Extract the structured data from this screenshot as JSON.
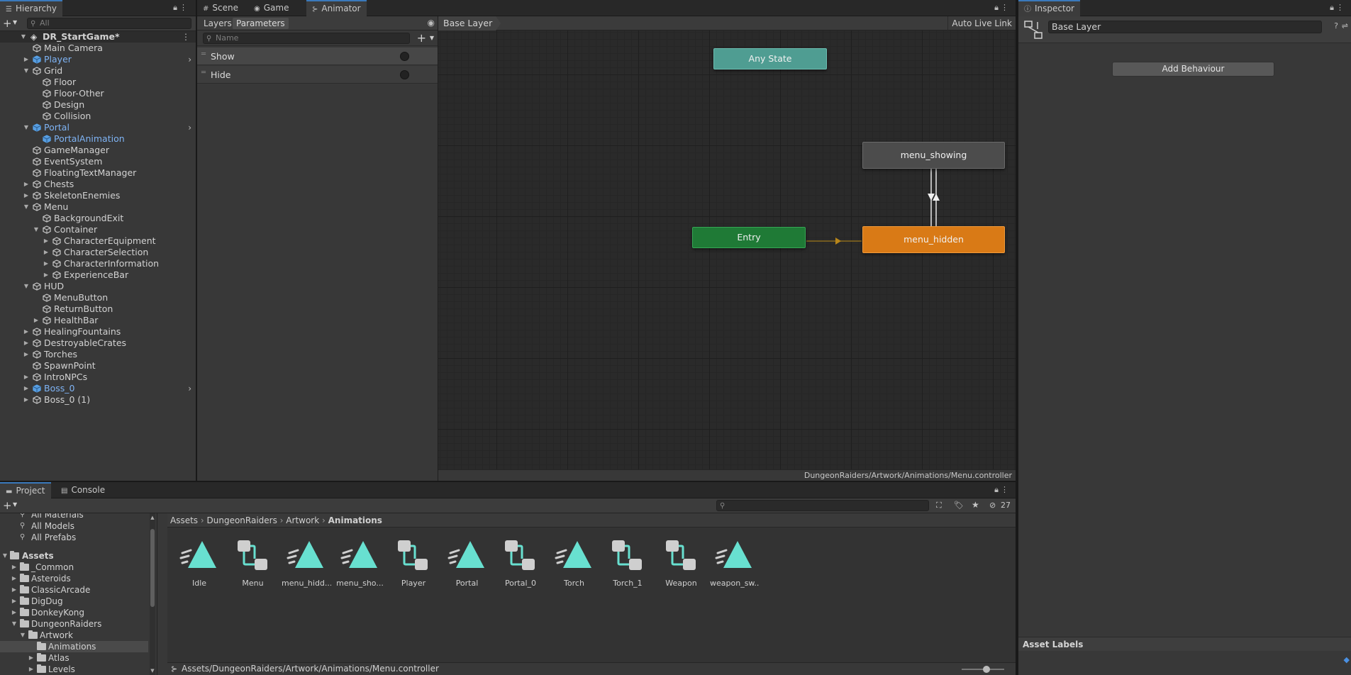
{
  "hierarchy": {
    "tab_label": "Hierarchy",
    "search_placeholder": "All",
    "scene_name": "DR_StartGame*",
    "items": [
      {
        "label": "Main Camera",
        "depth": 1,
        "arrow": "",
        "prefab": false,
        "chevron": false
      },
      {
        "label": "Player",
        "depth": 1,
        "arrow": "right",
        "prefab": true,
        "chevron": true
      },
      {
        "label": "Grid",
        "depth": 1,
        "arrow": "down",
        "prefab": false,
        "chevron": false
      },
      {
        "label": "Floor",
        "depth": 2,
        "arrow": "",
        "prefab": false,
        "chevron": false
      },
      {
        "label": "Floor-Other",
        "depth": 2,
        "arrow": "",
        "prefab": false,
        "chevron": false
      },
      {
        "label": "Design",
        "depth": 2,
        "arrow": "",
        "prefab": false,
        "chevron": false
      },
      {
        "label": "Collision",
        "depth": 2,
        "arrow": "",
        "prefab": false,
        "chevron": false
      },
      {
        "label": "Portal",
        "depth": 1,
        "arrow": "down",
        "prefab": true,
        "chevron": true
      },
      {
        "label": "PortalAnimation",
        "depth": 2,
        "arrow": "",
        "prefab": true,
        "chevron": false
      },
      {
        "label": "GameManager",
        "depth": 1,
        "arrow": "",
        "prefab": false,
        "chevron": false
      },
      {
        "label": "EventSystem",
        "depth": 1,
        "arrow": "",
        "prefab": false,
        "chevron": false
      },
      {
        "label": "FloatingTextManager",
        "depth": 1,
        "arrow": "",
        "prefab": false,
        "chevron": false
      },
      {
        "label": "Chests",
        "depth": 1,
        "arrow": "right",
        "prefab": false,
        "chevron": false
      },
      {
        "label": "SkeletonEnemies",
        "depth": 1,
        "arrow": "right",
        "prefab": false,
        "chevron": false
      },
      {
        "label": "Menu",
        "depth": 1,
        "arrow": "down",
        "prefab": false,
        "chevron": false
      },
      {
        "label": "BackgroundExit",
        "depth": 2,
        "arrow": "",
        "prefab": false,
        "chevron": false
      },
      {
        "label": "Container",
        "depth": 2,
        "arrow": "down",
        "prefab": false,
        "chevron": false
      },
      {
        "label": "CharacterEquipment",
        "depth": 3,
        "arrow": "right",
        "prefab": false,
        "chevron": false
      },
      {
        "label": "CharacterSelection",
        "depth": 3,
        "arrow": "right",
        "prefab": false,
        "chevron": false
      },
      {
        "label": "CharacterInformation",
        "depth": 3,
        "arrow": "right",
        "prefab": false,
        "chevron": false
      },
      {
        "label": "ExperienceBar",
        "depth": 3,
        "arrow": "right",
        "prefab": false,
        "chevron": false
      },
      {
        "label": "HUD",
        "depth": 1,
        "arrow": "down",
        "prefab": false,
        "chevron": false
      },
      {
        "label": "MenuButton",
        "depth": 2,
        "arrow": "",
        "prefab": false,
        "chevron": false
      },
      {
        "label": "ReturnButton",
        "depth": 2,
        "arrow": "",
        "prefab": false,
        "chevron": false
      },
      {
        "label": "HealthBar",
        "depth": 2,
        "arrow": "right",
        "prefab": false,
        "chevron": false
      },
      {
        "label": "HealingFountains",
        "depth": 1,
        "arrow": "right",
        "prefab": false,
        "chevron": false
      },
      {
        "label": "DestroyableCrates",
        "depth": 1,
        "arrow": "right",
        "prefab": false,
        "chevron": false
      },
      {
        "label": "Torches",
        "depth": 1,
        "arrow": "right",
        "prefab": false,
        "chevron": false
      },
      {
        "label": "SpawnPoint",
        "depth": 1,
        "arrow": "",
        "prefab": false,
        "chevron": false
      },
      {
        "label": "IntroNPCs",
        "depth": 1,
        "arrow": "right",
        "prefab": false,
        "chevron": false
      },
      {
        "label": "Boss_0",
        "depth": 1,
        "arrow": "right",
        "prefab": true,
        "chevron": true
      },
      {
        "label": "Boss_0 (1)",
        "depth": 1,
        "arrow": "right",
        "prefab": false,
        "chevron": false
      }
    ]
  },
  "center_tabs": {
    "scene": "Scene",
    "game": "Game",
    "animator": "Animator"
  },
  "animator": {
    "layers_tab": "Layers",
    "parameters_tab": "Parameters",
    "name_placeholder": "Name",
    "parameters": [
      "Show",
      "Hide"
    ],
    "breadcrumb": "Base Layer",
    "auto_live_link": "Auto Live Link",
    "nodes": {
      "any_state": "Any State",
      "entry": "Entry",
      "menu_showing": "menu_showing",
      "menu_hidden": "menu_hidden"
    },
    "footer_path": "DungeonRaiders/Artwork/Animations/Menu.controller",
    "colors": {
      "any_state": "#4f9d92",
      "entry": "#1f7a36",
      "default_state": "#d97a16",
      "state": "#4c4c4c"
    }
  },
  "inspector": {
    "tab_label": "Inspector",
    "layer_name": "Base Layer",
    "add_behaviour": "Add Behaviour",
    "asset_labels": "Asset Labels"
  },
  "project": {
    "tab_label": "Project",
    "console_label": "Console",
    "hidden_count": "27",
    "favorites": [
      "All Materials",
      "All Models",
      "All Prefabs"
    ],
    "assets_root": "Assets",
    "folders": [
      {
        "label": "_Common",
        "depth": 1,
        "arrow": "right"
      },
      {
        "label": "Asteroids",
        "depth": 1,
        "arrow": "right"
      },
      {
        "label": "ClassicArcade",
        "depth": 1,
        "arrow": "right"
      },
      {
        "label": "DigDug",
        "depth": 1,
        "arrow": "right"
      },
      {
        "label": "DonkeyKong",
        "depth": 1,
        "arrow": "right"
      },
      {
        "label": "DungeonRaiders",
        "depth": 1,
        "arrow": "down"
      },
      {
        "label": "Artwork",
        "depth": 2,
        "arrow": "down"
      },
      {
        "label": "Animations",
        "depth": 3,
        "arrow": ""
      },
      {
        "label": "Atlas",
        "depth": 3,
        "arrow": "right"
      },
      {
        "label": "Levels",
        "depth": 3,
        "arrow": "right"
      }
    ],
    "breadcrumb": [
      "Assets",
      "DungeonRaiders",
      "Artwork",
      "Animations"
    ],
    "assets": [
      {
        "name": "Idle",
        "kind": "clip"
      },
      {
        "name": "Menu",
        "kind": "controller"
      },
      {
        "name": "menu_hidd...",
        "kind": "clip"
      },
      {
        "name": "menu_sho...",
        "kind": "clip"
      },
      {
        "name": "Player",
        "kind": "controller"
      },
      {
        "name": "Portal",
        "kind": "clip"
      },
      {
        "name": "Portal_0",
        "kind": "controller"
      },
      {
        "name": "Torch",
        "kind": "clip"
      },
      {
        "name": "Torch_1",
        "kind": "controller"
      },
      {
        "name": "Weapon",
        "kind": "controller"
      },
      {
        "name": "weapon_sw...",
        "kind": "clip"
      }
    ],
    "footer_path": "Assets/DungeonRaiders/Artwork/Animations/Menu.controller"
  }
}
